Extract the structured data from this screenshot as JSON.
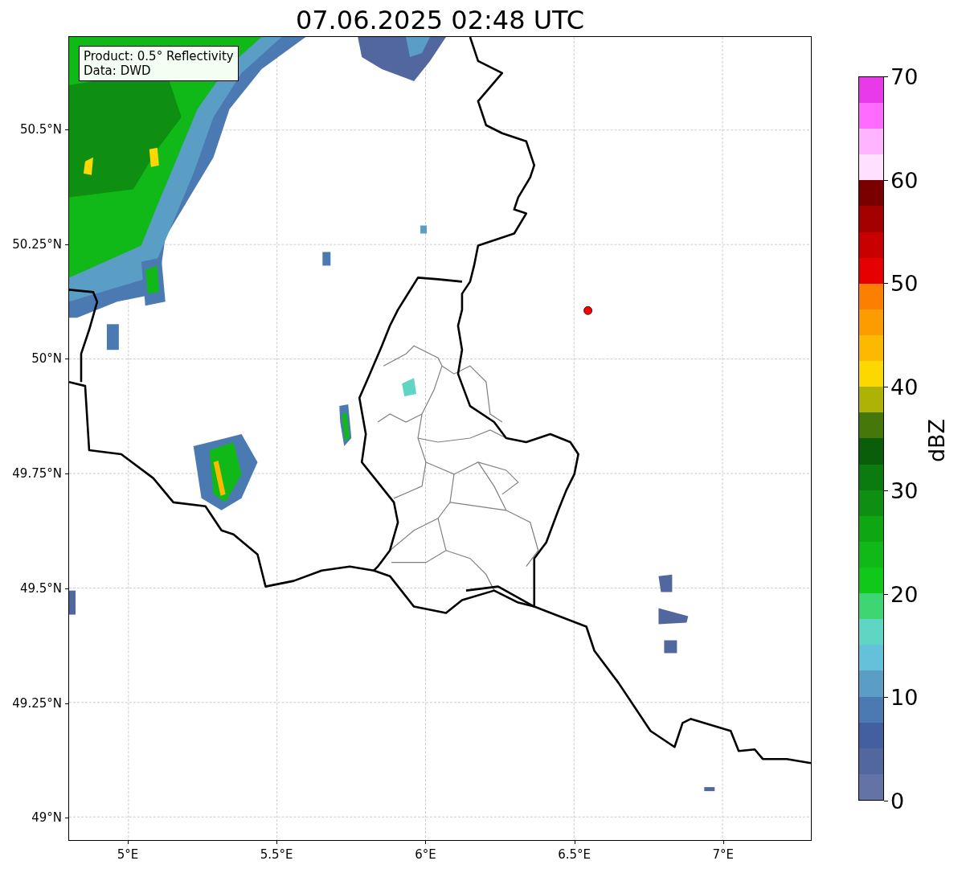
{
  "title": "07.06.2025 02:48 UTC",
  "info_box": {
    "lines": [
      "Product: 0.5° Reflectivity",
      "Data: DWD"
    ]
  },
  "map": {
    "lat_ticks": [
      "50.5°N",
      "50.25°N",
      "50°N",
      "49.75°N",
      "49.5°N",
      "49.25°N",
      "49°N"
    ],
    "lon_ticks": [
      "5°E",
      "5.5°E",
      "6°E",
      "6.5°E",
      "7°E"
    ]
  },
  "colorbar": {
    "label": "dBZ",
    "ticks": [
      "70",
      "60",
      "50",
      "40",
      "30",
      "20",
      "10",
      "0"
    ],
    "segments": [
      {
        "color": "#6473a6"
      },
      {
        "color": "#52679e"
      },
      {
        "color": "#435fa0"
      },
      {
        "color": "#4b7ab2"
      },
      {
        "color": "#5a9ec5"
      },
      {
        "color": "#63c1d9"
      },
      {
        "color": "#5fd6c4"
      },
      {
        "color": "#3dd672"
      },
      {
        "color": "#10c81a"
      },
      {
        "color": "#10b818"
      },
      {
        "color": "#0fa614"
      },
      {
        "color": "#0e8f11"
      },
      {
        "color": "#0b7a0f"
      },
      {
        "color": "#0a5e0a"
      },
      {
        "color": "#46770a"
      },
      {
        "color": "#adb204"
      },
      {
        "color": "#fdd800"
      },
      {
        "color": "#fdb900"
      },
      {
        "color": "#fd9c00"
      },
      {
        "color": "#fd7f00"
      },
      {
        "color": "#e60000"
      },
      {
        "color": "#c80000"
      },
      {
        "color": "#a50000"
      },
      {
        "color": "#7a0000"
      },
      {
        "color": "#ffe0ff"
      },
      {
        "color": "#ffb4ff"
      },
      {
        "color": "#ff6bff"
      },
      {
        "color": "#e83ae8"
      }
    ]
  }
}
